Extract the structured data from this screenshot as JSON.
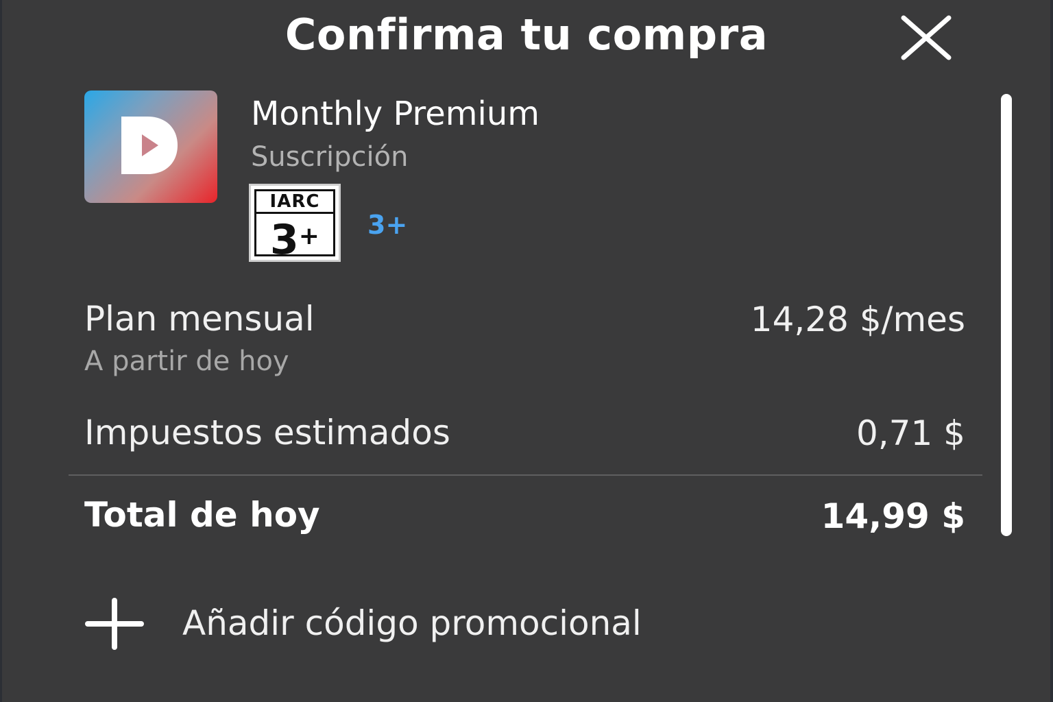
{
  "dialog": {
    "title": "Confirma tu compra",
    "close_icon": "close-icon"
  },
  "product": {
    "icon": "app-logo-icon",
    "name": "Monthly Premium",
    "type": "Suscripción",
    "rating": {
      "badge_org": "IARC",
      "badge_age": "3",
      "badge_plus": "+",
      "link_text": "3+"
    }
  },
  "pricing": {
    "plan_label": "Plan mensual",
    "plan_sub": "A partir de hoy",
    "plan_value": "14,28 $/mes",
    "tax_label": "Impuestos estimados",
    "tax_value": "0,71 $",
    "total_label": "Total de hoy",
    "total_value": "14,99 $"
  },
  "promo": {
    "icon": "plus-icon",
    "label": "Añadir código promocional"
  },
  "colors": {
    "background": "#3a3a3b",
    "accent_link": "#4aa3f0",
    "text_primary": "#ffffff",
    "text_secondary": "#b3b3b3"
  }
}
